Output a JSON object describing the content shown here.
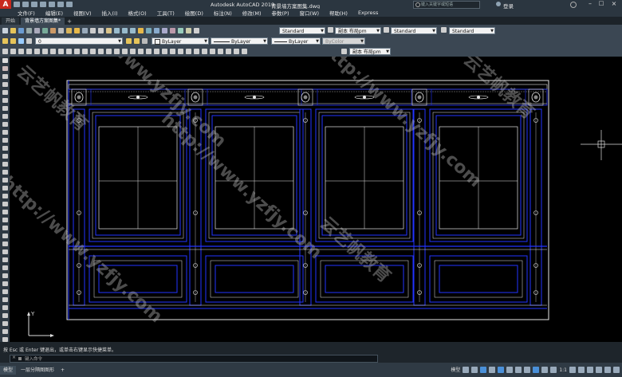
{
  "app": {
    "title": "Autodesk AutoCAD 2019",
    "filename": "背景墙方案图集.dwg"
  },
  "search": {
    "placeholder": "键入关键字或短语"
  },
  "user": {
    "login_label": "登录"
  },
  "menu": [
    "文件(F)",
    "编辑(E)",
    "视图(V)",
    "插入(I)",
    "格式(O)",
    "工具(T)",
    "绘图(D)",
    "标注(N)",
    "修改(M)",
    "参数(P)",
    "窗口(W)",
    "帮助(H)",
    "Express"
  ],
  "tabs": [
    {
      "label": "开始"
    },
    {
      "label": "背景墙方案图集*"
    }
  ],
  "props": {
    "layer_value": "0",
    "color": "ByLayer",
    "linetype": "ByLayer",
    "lineweight": "ByLayer",
    "plotstyle": "ByColor",
    "text_style": "Standard",
    "dim_style": "副本 布局pm",
    "table_style": "Standard",
    "mleader_style": "Standard",
    "mleader_dim": "副本 布局pm"
  },
  "command": {
    "history": "按 Esc 或 Enter 键退出，或单击右键显示快捷菜单。",
    "prompt_placeholder": "键入命令"
  },
  "status": {
    "layout_tabs": [
      "模型",
      "一层分隔图图形"
    ],
    "model_label": "模型",
    "scale": "1:1"
  },
  "ucs": {
    "y_label": "Y"
  },
  "watermarks": [
    "http://www.yzfjy.com",
    "云艺帆教育"
  ],
  "colors": {
    "drawing_blue": "#2233ff",
    "drawing_white": "#e6e6e6",
    "accent_red": "#c8281e"
  }
}
